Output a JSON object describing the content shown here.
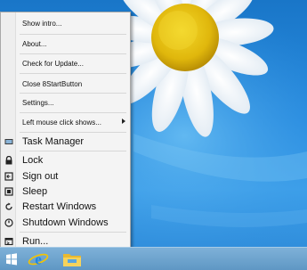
{
  "menu": {
    "items": [
      {
        "label": "Show intro..."
      },
      {
        "label": "About..."
      },
      {
        "label": "Check for Update..."
      },
      {
        "label": "Close 8StartButton"
      },
      {
        "label": "Settings..."
      },
      {
        "label": "Left mouse click shows..."
      },
      {
        "label": "Task Manager",
        "icon": "task-manager-icon"
      },
      {
        "label": "Lock",
        "icon": "lock-icon"
      },
      {
        "label": "Sign out",
        "icon": "sign-out-icon"
      },
      {
        "label": "Sleep",
        "icon": "sleep-icon"
      },
      {
        "label": "Restart Windows",
        "icon": "restart-icon"
      },
      {
        "label": "Shutdown Windows",
        "icon": "shutdown-icon"
      },
      {
        "label": "Run...",
        "icon": "run-icon"
      }
    ]
  },
  "taskbar": {
    "items": [
      {
        "icon": "windows-start-icon"
      },
      {
        "icon": "internet-explorer-icon"
      },
      {
        "icon": "file-explorer-icon"
      }
    ]
  },
  "colors": {
    "desktop_blue": "#2a8de0",
    "menu_bg": "#f4f4f4",
    "taskbar": "#6aa3cf",
    "flower_center": "#e8c20e"
  }
}
